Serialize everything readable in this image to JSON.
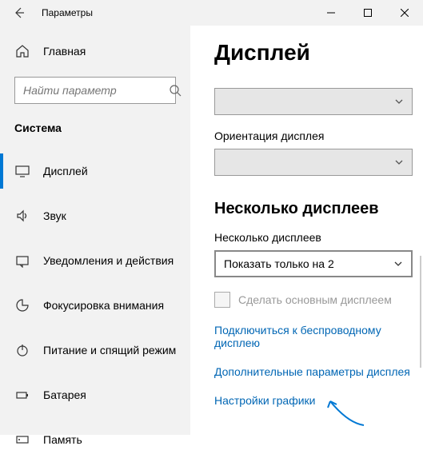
{
  "window": {
    "title": "Параметры"
  },
  "sidebar": {
    "home": "Главная",
    "search_placeholder": "Найти параметр",
    "category": "Система",
    "items": [
      {
        "label": "Дисплей"
      },
      {
        "label": "Звук"
      },
      {
        "label": "Уведомления и действия"
      },
      {
        "label": "Фокусировка внимания"
      },
      {
        "label": "Питание и спящий режим"
      },
      {
        "label": "Батарея"
      },
      {
        "label": "Память"
      }
    ]
  },
  "main": {
    "page_title": "Дисплей",
    "orientation_label": "Ориентация дисплея",
    "multi_heading": "Несколько дисплеев",
    "multi_label": "Несколько дисплеев",
    "multi_selected": "Показать только на 2",
    "primary_checkbox": "Сделать основным дисплеем",
    "links": {
      "wireless": "Подключиться к беспроводному дисплею",
      "advanced": "Дополнительные параметры дисплея",
      "graphics": "Настройки графики"
    }
  }
}
